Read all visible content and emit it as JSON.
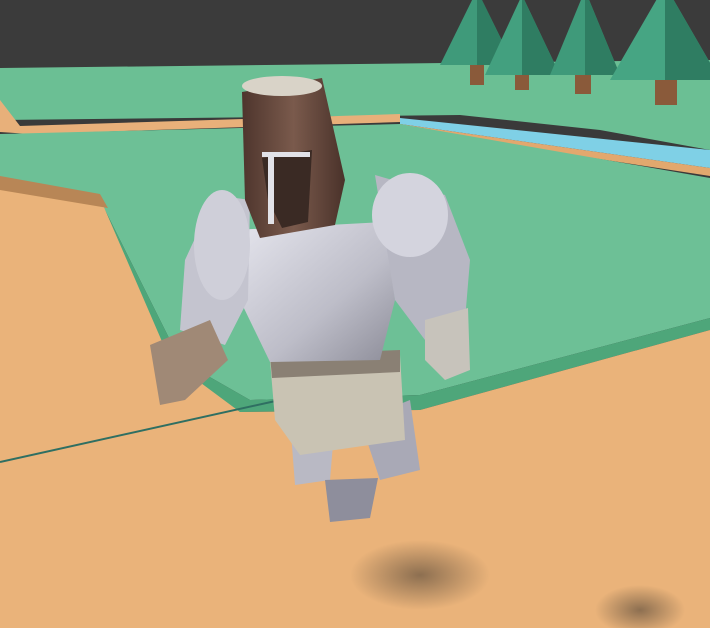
{
  "scene": {
    "description_kind": "3d-game-viewport",
    "sky_color": "#3b3b3b",
    "grass_color": "#6bbf94",
    "grass_dark_color": "#4ea67a",
    "ground_color": "#eab37a",
    "ground_edge_color": "#b88656",
    "water_color": "#7fd0e6",
    "tree_color": "#3f9a7a",
    "tree_dark_color": "#2f7d62",
    "trunk_color": "#8a5a3a",
    "armor_color": "#cfcfd8",
    "armor_shade_color": "#9a9aa8",
    "helmet_color": "#6a4a3e",
    "shadow_color": "#5a4a3a"
  },
  "objects": {
    "character": "armored-knight",
    "trees": "low-poly-pine-trees"
  }
}
